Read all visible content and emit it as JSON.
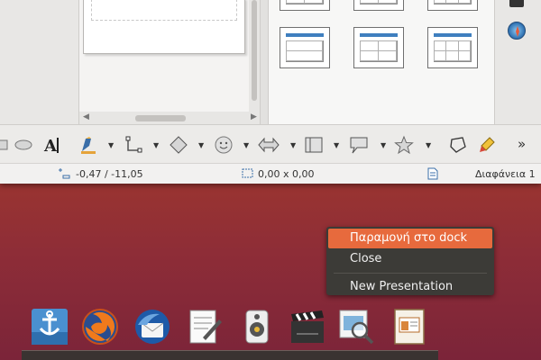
{
  "statusbar": {
    "position": "-0,47 / -11,05",
    "size": "0,00 x 0,00",
    "slide": "Διαφάνεια 1"
  },
  "toolbar": {
    "overflow": "»",
    "items": [
      "ellipse-icon",
      "fontwork-icon",
      "line-color-icon",
      "connector-icon",
      "basic-shapes-icon",
      "symbol-shapes-icon",
      "block-arrows-icon",
      "flowchart-icon",
      "callouts-icon",
      "stars-icon",
      "points-icon",
      "glue-icon"
    ]
  },
  "context_menu": {
    "items": [
      "Παραμονή στο dock",
      "Close",
      "New Presentation"
    ],
    "highlighted": 0
  },
  "dock": {
    "apps": [
      "anchor-app-icon",
      "firefox-icon",
      "thunderbird-icon",
      "text-editor-icon",
      "speaker-icon",
      "video-clapper-icon",
      "image-viewer-icon",
      "presentation-icon"
    ]
  },
  "colors": {
    "menu_highlight": "#e76a3d",
    "menu_bg": "#3c3b37",
    "desktop": "#a33a2c",
    "layout_accent": "#3f7fbf"
  }
}
